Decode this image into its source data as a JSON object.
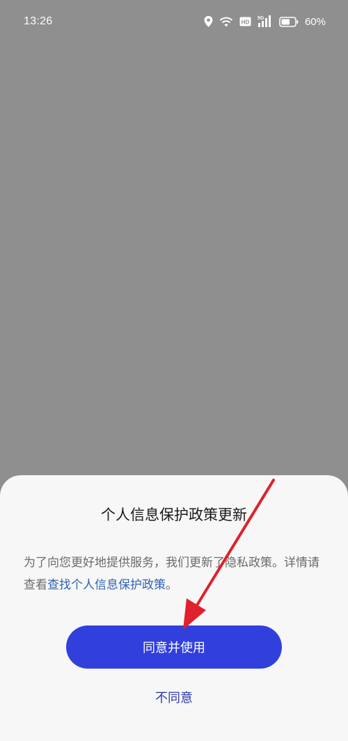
{
  "status_bar": {
    "time": "13:26",
    "battery_percent": "60%",
    "icons": [
      "location-icon",
      "wifi-icon",
      "hd-icon",
      "5g-signal-icon",
      "battery-icon"
    ]
  },
  "dialog": {
    "title": "个人信息保护政策更新",
    "body_text": "为了向您更好地提供服务，我们更新了隐私政策。详情请查看",
    "link_text": "查找个人信息保护政策",
    "body_suffix": "。",
    "agree_label": "同意并使用",
    "disagree_label": "不同意"
  },
  "colors": {
    "overlay": "#8f8f8f",
    "sheet_background": "#f7f7f7",
    "primary_button": "#3140dd",
    "link": "#2f63b0",
    "annotation_arrow": "#e0202a"
  }
}
